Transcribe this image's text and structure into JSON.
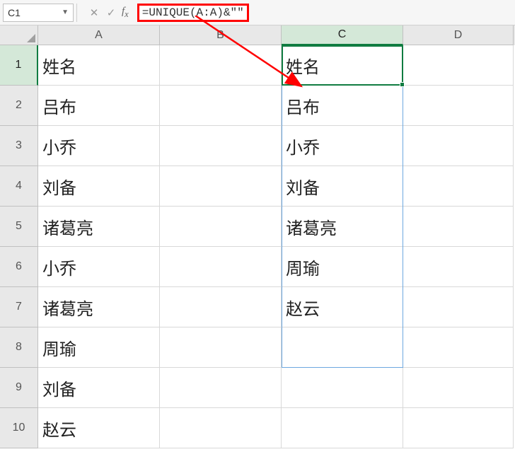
{
  "name_box": {
    "value": "C1"
  },
  "formula": "=UNIQUE(A:A)&\"\"",
  "columns": [
    "A",
    "B",
    "C",
    "D"
  ],
  "row_numbers": [
    "1",
    "2",
    "3",
    "4",
    "5",
    "6",
    "7",
    "8",
    "9",
    "10"
  ],
  "active_cell": "C1",
  "data_a": [
    "姓名",
    "吕布",
    "小乔",
    "刘备",
    "诸葛亮",
    "小乔",
    "诸葛亮",
    "周瑜",
    "刘备",
    "赵云"
  ],
  "data_c": [
    "姓名",
    "吕布",
    "小乔",
    "刘备",
    "诸葛亮",
    "周瑜",
    "赵云",
    ""
  ]
}
